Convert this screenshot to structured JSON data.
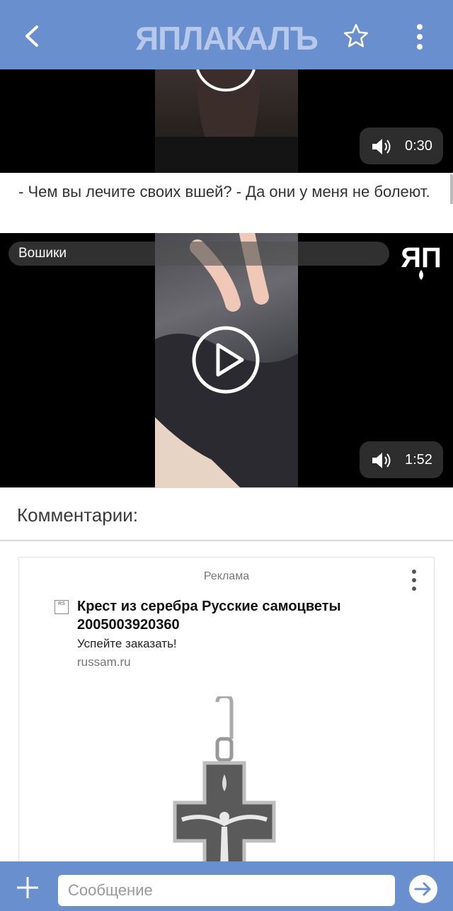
{
  "header": {
    "logo_text": "ЯПЛАКАЛЪ",
    "back_icon": "chevron-left-icon",
    "favorite_icon": "star-outline-icon",
    "menu_icon": "more-vertical-icon",
    "color": "#6a8fce"
  },
  "video1": {
    "duration": "0:30",
    "volume_icon": "speaker-icon"
  },
  "post": {
    "caption": "- Чем вы лечите своих вшей? - Да они у меня не болеют."
  },
  "video2": {
    "title": "Вошики",
    "watermark": "ЯП",
    "duration": "1:52",
    "play_icon": "play-icon",
    "volume_icon": "speaker-icon"
  },
  "comments": {
    "title": "Комментарии:"
  },
  "ad": {
    "label": "Реклама",
    "icon_text": "RS",
    "title": "Крест из серебра Русские самоцветы 2005003920360",
    "description": "Успейте заказать!",
    "domain": "russam.ru",
    "image": "silver-cross-pendant"
  },
  "composer": {
    "placeholder": "Сообщение",
    "add_icon": "plus-icon",
    "send_icon": "send-arrow-icon"
  }
}
